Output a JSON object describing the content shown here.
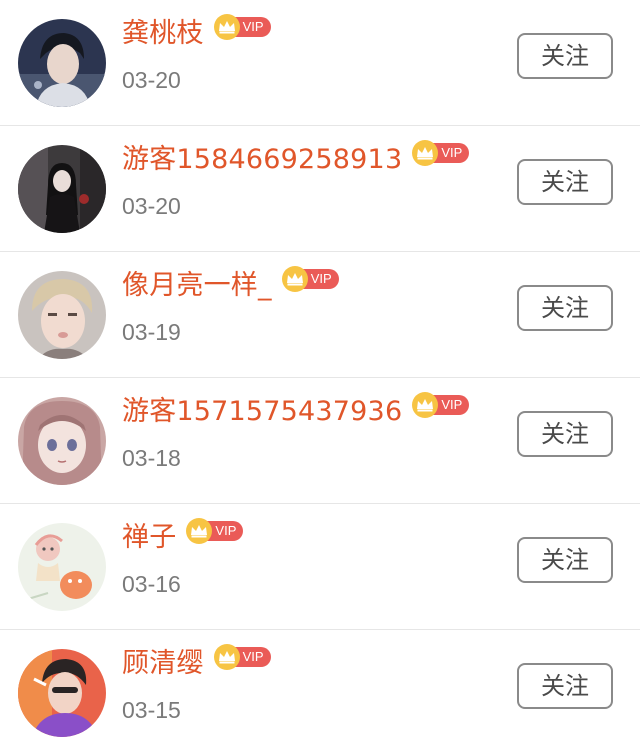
{
  "users": [
    {
      "name": "龚桃枝",
      "vip_label": "VIP",
      "date": "03-20",
      "follow_label": "关注",
      "avatar": "avatar-dark-hair-portrait"
    },
    {
      "name": "游客1584669258913",
      "vip_label": "VIP",
      "date": "03-20",
      "follow_label": "关注",
      "avatar": "avatar-dark-figure"
    },
    {
      "name": "像月亮一样_",
      "vip_label": "VIP",
      "date": "03-19",
      "follow_label": "关注",
      "avatar": "avatar-light-hair-portrait"
    },
    {
      "name": "游客1571575437936",
      "vip_label": "VIP",
      "date": "03-18",
      "follow_label": "关注",
      "avatar": "avatar-anime-girl"
    },
    {
      "name": "禅子",
      "vip_label": "VIP",
      "date": "03-16",
      "follow_label": "关注",
      "avatar": "avatar-cartoon-sketch"
    },
    {
      "name": "顾清缨",
      "vip_label": "VIP",
      "date": "03-15",
      "follow_label": "关注",
      "avatar": "avatar-purple-portrait"
    }
  ],
  "colors": {
    "name": "#e0562a",
    "vip_badge": "#ea5b57",
    "vip_crown": "#f7c443",
    "date": "#7a7a7a",
    "button_border": "#8a8a8a",
    "divider": "#e6e6e6"
  }
}
